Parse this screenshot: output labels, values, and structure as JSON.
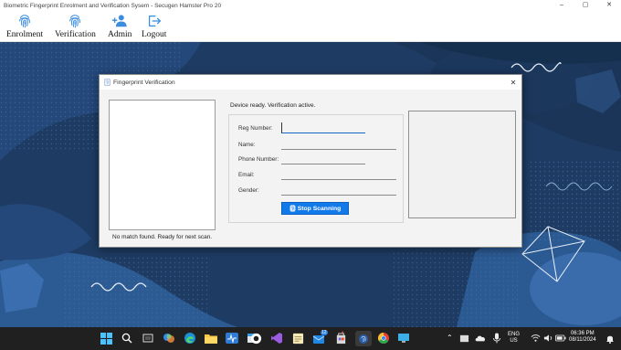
{
  "app": {
    "title": "Biometric Fingerprint Enrolment and Verification Sysem - Secugen Hamster Pro 20",
    "window_controls": [
      "–",
      "▢",
      "✕"
    ]
  },
  "menu": {
    "items": [
      {
        "label": "Enrolment",
        "icon": "fingerprint-icon"
      },
      {
        "label": "Verification",
        "icon": "fingerprint-icon"
      },
      {
        "label": "Admin",
        "icon": "add-user-icon"
      },
      {
        "label": "Logout",
        "icon": "logout-icon"
      }
    ]
  },
  "dialog": {
    "title": "Fingerprint Verification",
    "close_label": "✕",
    "device_status": "Device ready. Verification active.",
    "match_status": "No match found. Ready for next scan.",
    "fields": {
      "reg_number": {
        "label": "Reg Number:",
        "value": ""
      },
      "name": {
        "label": "Name:",
        "value": ""
      },
      "phone": {
        "label": "Phone Number:",
        "value": ""
      },
      "email": {
        "label": "Email:",
        "value": ""
      },
      "gender": {
        "label": "Gender:",
        "value": ""
      }
    },
    "scan_button": "Stop Scanning"
  },
  "taskbar": {
    "language": "ENG",
    "region": "US",
    "time": "06:36 PM",
    "date": "08/11/2024",
    "badges": {
      "mail": "12",
      "notes": "•"
    }
  },
  "colors": {
    "accent": "#1179e8",
    "desktop": "#1e3c63",
    "taskbar": "#202020",
    "menu_icon": "#3b8de0"
  }
}
